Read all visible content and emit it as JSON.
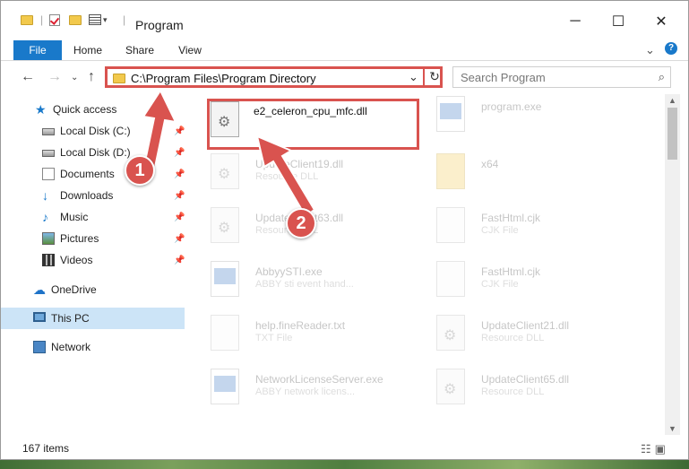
{
  "window": {
    "title": "Program",
    "controls": {
      "minimize": "─",
      "maximize": "☐",
      "close": "✕"
    }
  },
  "ribbon": {
    "tabs": [
      "File",
      "Home",
      "Share",
      "View"
    ],
    "help": "?"
  },
  "nav": {
    "address": "C:\\Program Files\\Program Directory",
    "search_placeholder": "Search Program"
  },
  "sidebar": {
    "items": [
      {
        "label": "Quick access",
        "icon": "star-icon",
        "pinned": false
      },
      {
        "label": "Local Disk (C:)",
        "icon": "drive-icon",
        "pinned": true
      },
      {
        "label": "Local Disk (D:)",
        "icon": "drive-icon",
        "pinned": true
      },
      {
        "label": "Documents",
        "icon": "documents-icon",
        "pinned": true
      },
      {
        "label": "Downloads",
        "icon": "download-icon",
        "pinned": true
      },
      {
        "label": "Music",
        "icon": "music-icon",
        "pinned": true
      },
      {
        "label": "Pictures",
        "icon": "pictures-icon",
        "pinned": true
      },
      {
        "label": "Videos",
        "icon": "videos-icon",
        "pinned": true
      },
      {
        "label": "OneDrive",
        "icon": "cloud-icon",
        "pinned": false
      },
      {
        "label": "This PC",
        "icon": "pc-icon",
        "pinned": false,
        "selected": true
      },
      {
        "label": "Network",
        "icon": "network-icon",
        "pinned": false
      }
    ]
  },
  "files": [
    {
      "name": "e2_celeron_cpu_mfc.dll",
      "type": "",
      "icon": "dll-file-icon",
      "highlighted": true
    },
    {
      "name": "program.exe",
      "type": "",
      "icon": "exe-file-icon"
    },
    {
      "name": "UpdateClient19.dll",
      "type": "Resource DLL",
      "icon": "dll-file-icon"
    },
    {
      "name": "x64",
      "type": "",
      "icon": "folder-icon"
    },
    {
      "name": "UpdateClient63.dll",
      "type": "Resource DLL",
      "icon": "dll-file-icon"
    },
    {
      "name": "FastHtml.cjk",
      "type": "CJK File",
      "icon": "file-icon"
    },
    {
      "name": "AbbyySTI.exe",
      "type": "ABBY sti event hand...",
      "icon": "exe-file-icon"
    },
    {
      "name": "FastHtml.cjk",
      "type": "CJK File",
      "icon": "file-icon"
    },
    {
      "name": "help.fineReader.txt",
      "type": "TXT File",
      "icon": "text-file-icon"
    },
    {
      "name": "UpdateClient21.dll",
      "type": "Resource DLL",
      "icon": "dll-file-icon"
    },
    {
      "name": "NetworkLicenseServer.exe",
      "type": "ABBY network licens...",
      "icon": "exe-file-icon"
    },
    {
      "name": "UpdateClient65.dll",
      "type": "Resource DLL",
      "icon": "dll-file-icon"
    }
  ],
  "annotations": {
    "step1": "1",
    "step2": "2",
    "color": "#d9534f"
  },
  "status": {
    "item_count": "167 items"
  },
  "colors": {
    "accent": "#1979ca",
    "selection": "#cce4f7",
    "annotation": "#d9534f"
  }
}
